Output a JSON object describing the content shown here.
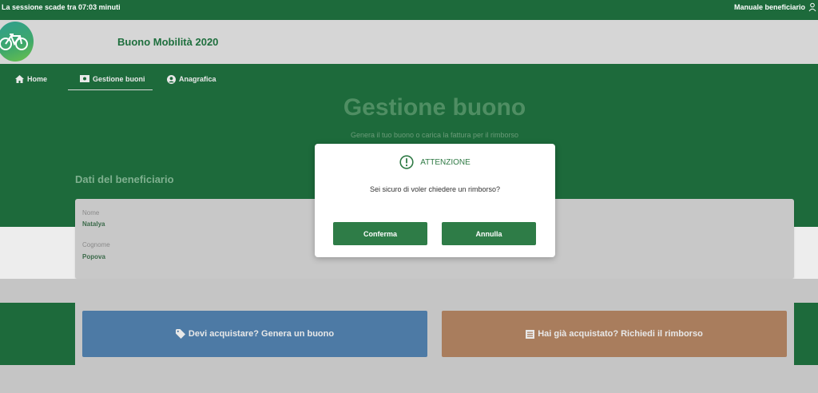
{
  "topbar": {
    "session_text": "La sessione scade tra 07:03 minuti",
    "manual_link": "Manuale beneficiario"
  },
  "header": {
    "app_title": "Buono Mobilità 2020",
    "logo_icon": "bicycle-icon"
  },
  "nav": {
    "items": [
      {
        "label": "Home",
        "icon": "home-icon"
      },
      {
        "label": "Gestione buoni",
        "icon": "ticket-icon",
        "active": true
      },
      {
        "label": "Anagrafica",
        "icon": "user-circle-icon"
      }
    ]
  },
  "main": {
    "title": "Gestione buono",
    "subtitle": "Genera il tuo buono o carica la fattura per il rimborso",
    "section_title": "Dati del beneficiario",
    "beneficiary": {
      "name_label": "Nome",
      "name_value": "Natalya",
      "surname_label": "Cognome",
      "surname_value": "Popova"
    },
    "actions": {
      "generate_label": "Devi acquistare? Genera un buono",
      "generate_icon": "tag-icon",
      "refund_label": "Hai già acquistato? Richiedi il rimborso",
      "refund_icon": "list-icon"
    }
  },
  "modal": {
    "title": "ATTENZIONE",
    "icon": "exclamation-circle-icon",
    "message": "Sei sicuro di voler chiedere un rimborso?",
    "confirm_label": "Conferma",
    "cancel_label": "Annulla"
  },
  "colors": {
    "brand_green": "#1d6a3b",
    "button_green": "#2e7c47",
    "generate_blue": "#4d7aa5",
    "refund_orange": "#a97d5d"
  }
}
